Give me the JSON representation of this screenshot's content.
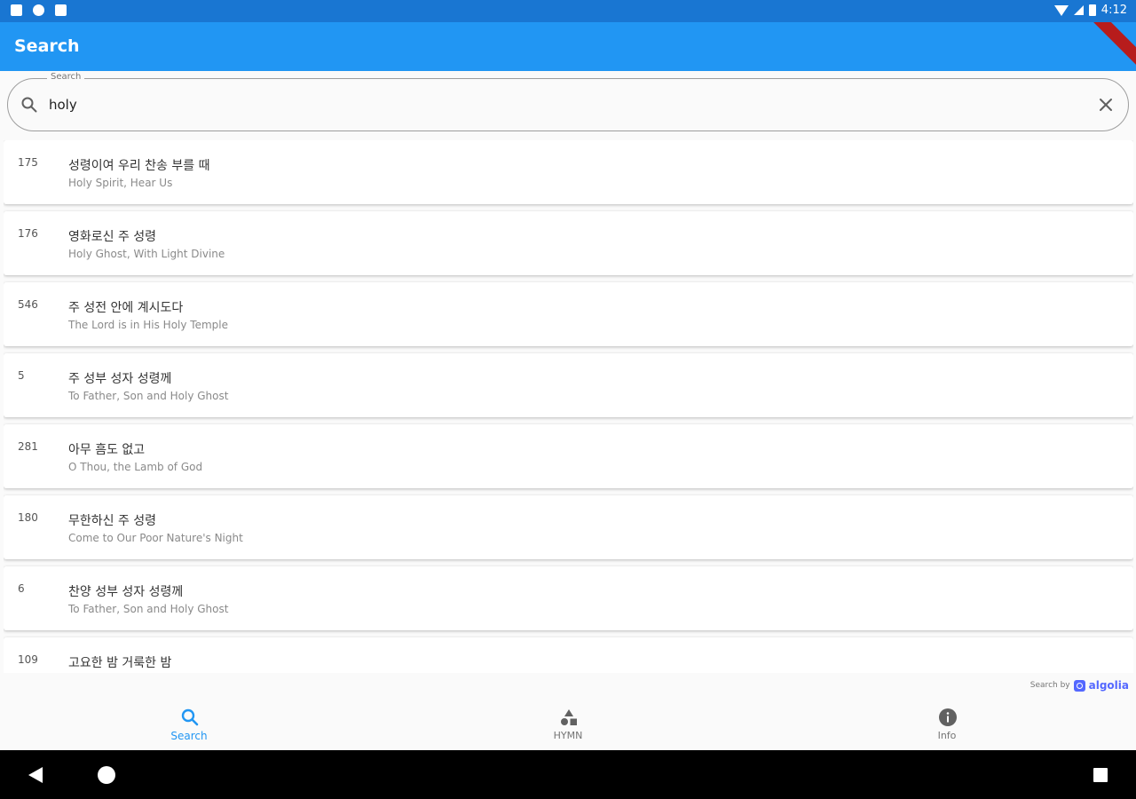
{
  "status_bar": {
    "time": "4:12"
  },
  "app_bar": {
    "title": "Search",
    "color": "#2196f3"
  },
  "search": {
    "label": "Search",
    "value": "holy",
    "placeholder": "",
    "icons": [
      "search-icon",
      "close-icon"
    ]
  },
  "results": [
    {
      "number": "175",
      "title": "성령이여 우리 찬송 부를 때",
      "subtitle": "Holy Spirit, Hear Us"
    },
    {
      "number": "176",
      "title": "영화로신 주 성령",
      "subtitle": "Holy Ghost, With Light Divine"
    },
    {
      "number": "546",
      "title": "주 성전 안에 계시도다",
      "subtitle": "The Lord is in His Holy Temple"
    },
    {
      "number": "5",
      "title": "주 성부 성자 성령께",
      "subtitle": "To Father, Son and Holy Ghost"
    },
    {
      "number": "281",
      "title": "아무 흠도 없고",
      "subtitle": "O Thou, the Lamb of God"
    },
    {
      "number": "180",
      "title": "무한하신 주 성령",
      "subtitle": "Come to Our Poor Nature's Night"
    },
    {
      "number": "6",
      "title": "찬양 성부 성자 성령께",
      "subtitle": "To Father, Son and Holy Ghost"
    },
    {
      "number": "109",
      "title": "고요한 밤 거룩한 밤",
      "subtitle": ""
    }
  ],
  "powered_by": {
    "prefix": "Search by",
    "brand": "algolia",
    "brand_color": "#5468ff"
  },
  "bottom_nav": {
    "items": [
      {
        "label": "Search",
        "icon": "search-icon",
        "active": true
      },
      {
        "label": "HYMN",
        "icon": "shapes-icon",
        "active": false
      },
      {
        "label": "Info",
        "icon": "info-icon",
        "active": false
      }
    ],
    "active_color": "#2196f3"
  }
}
